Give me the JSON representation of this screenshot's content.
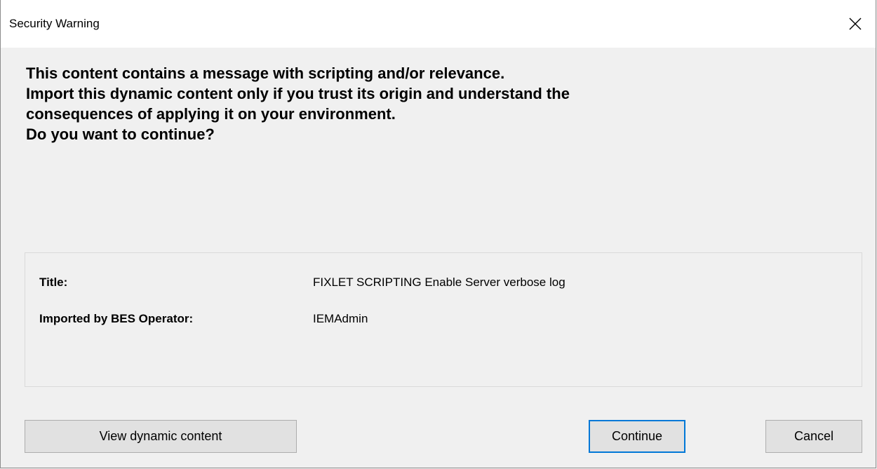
{
  "window": {
    "title": "Security Warning"
  },
  "message": {
    "lines": [
      "This content contains a message with scripting and/or relevance.",
      "Import this dynamic content only if you trust its origin and understand the",
      "consequences of applying it on your environment.",
      "Do you want to continue?"
    ]
  },
  "details": {
    "title_label": "Title:",
    "title_value": "FIXLET SCRIPTING Enable Server verbose log",
    "operator_label": "Imported by BES Operator:",
    "operator_value": "IEMAdmin"
  },
  "buttons": {
    "view_label": "View dynamic content",
    "continue_label": "Continue",
    "cancel_label": "Cancel"
  },
  "icons": {
    "close": "close-icon"
  },
  "colors": {
    "focus_border": "#0078d7",
    "dialog_bg": "#f0f0f0"
  }
}
